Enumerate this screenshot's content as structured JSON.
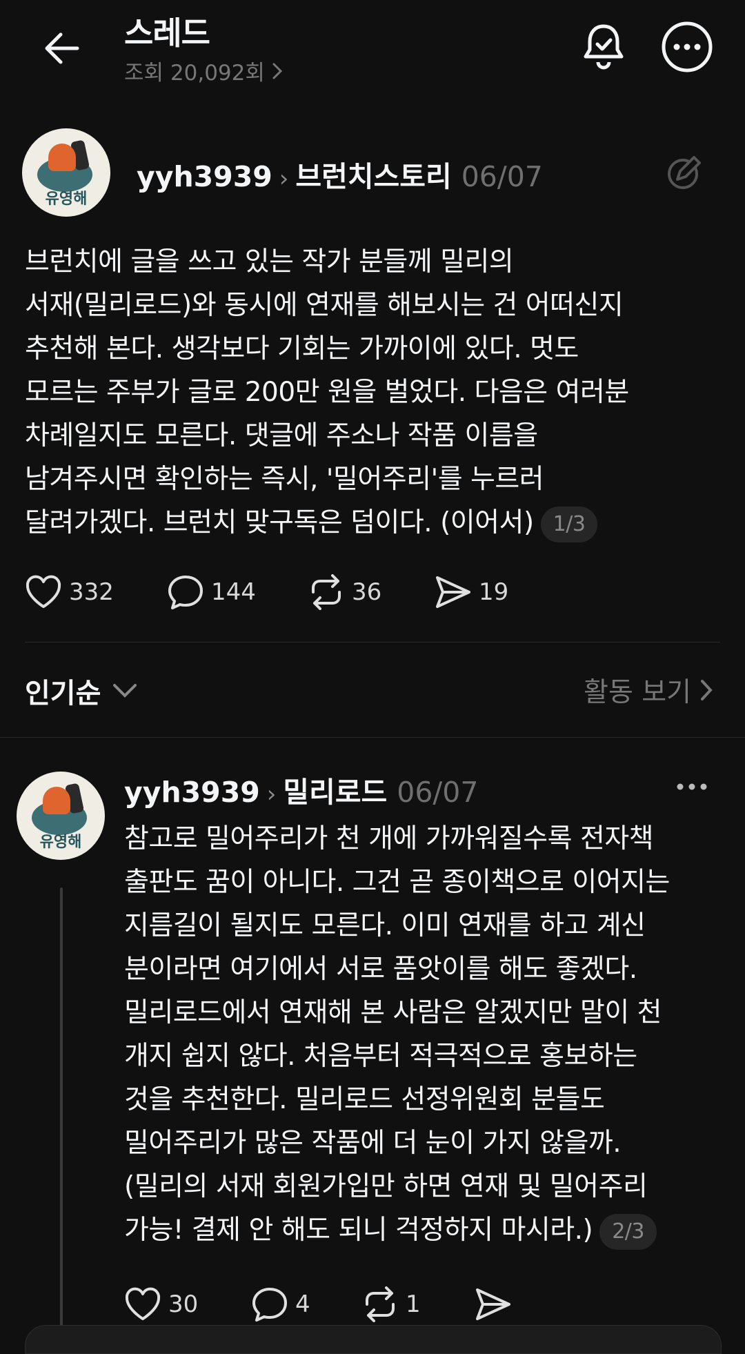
{
  "header": {
    "title": "스레드",
    "views": "조회 20,092회"
  },
  "post": {
    "avatar_label": "유영해",
    "username": "yyh3939",
    "community": "브런치스토리",
    "date": "06/07",
    "text": "브런치에 글을 쓰고 있는 작가 분들께 밀리의\n서재(밀리로드)와 동시에 연재를 해보시는 건 어떠신지\n추천해 본다. 생각보다 기회는 가까이에 있다. 멋도\n모르는 주부가 글로 200만 원을 벌었다. 다음은 여러분\n차례일지도 모른다. 댓글에 주소나 작품 이름을\n남겨주시면 확인하는 즉시, '밀어주리'를 누르러\n달려가겠다. 브런치 맞구독은 덤이다. (이어서)",
    "pager": "1/3",
    "likes": "332",
    "comments": "144",
    "reposts": "36",
    "shares": "19"
  },
  "sort_bar": {
    "sort_label": "인기순",
    "activity_label": "활동 보기"
  },
  "reply": {
    "avatar_label": "유영해",
    "username": "yyh3939",
    "community": "밀리로드",
    "date": "06/07",
    "text": "참고로 밀어주리가 천 개에 가까워질수록 전자책\n출판도 꿈이 아니다. 그건 곧 종이책으로 이어지는\n지름길이 될지도 모른다. 이미 연재를 하고 계신\n분이라면 여기에서 서로 품앗이를 해도 좋겠다.\n밀리로드에서 연재해 본 사람은 알겠지만 말이 천\n개지 쉽지 않다. 처음부터 적극적으로 홍보하는\n것을 추천한다. 밀리로드 선정위원회 분들도\n밀어주리가 많은 작품에 더 눈이 가지 않을까.\n(밀리의 서재 회원가입만 하면 연재 및 밀어주리\n가능! 결제 안 해도 되니 걱정하지 마시라.)",
    "pager": "2/3",
    "likes": "30",
    "comments": "4",
    "reposts": "1"
  },
  "colors": {
    "background": "#101010",
    "text": "#f3f5f7",
    "muted": "#777777"
  }
}
